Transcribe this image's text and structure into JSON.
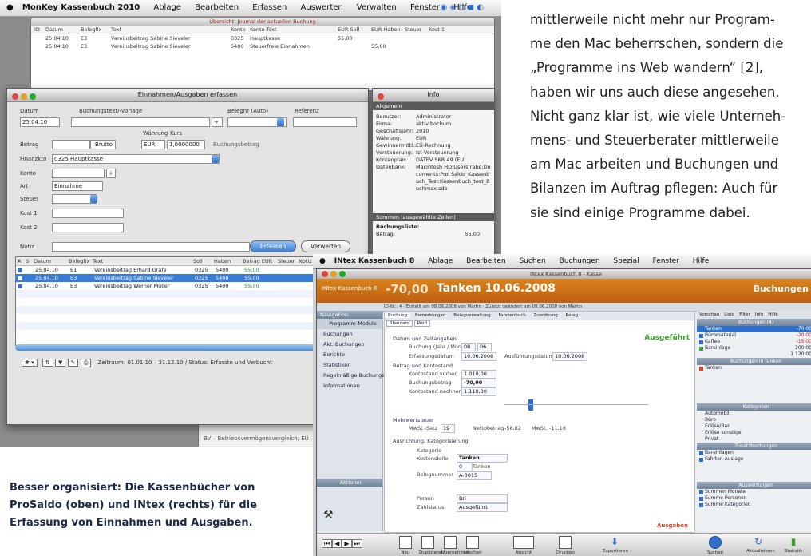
{
  "article": {
    "lines": [
      "mittlerweile nicht mehr nur Program-",
      "me den Mac beherrschen, sondern die",
      "„Programme ins Web wandern“ [2],",
      "haben wir uns auch diese angesehen.",
      "Nicht ganz klar ist, wie viele Unterneh-",
      "mens- und Steuerberater mittlerweile",
      "am Mac arbeiten und Buchungen und",
      "Bilanzen im Auftrag pflegen: Auch für",
      "sie sind einige Programme dabei."
    ]
  },
  "caption": {
    "lines": [
      "Besser organisiert: Die Kassenbücher von",
      "ProSaldo (oben) und INtex (rechts) für die",
      "Erfassung von Einnahmen und Ausgaben."
    ]
  },
  "monkey": {
    "menubar": {
      "app": "MonKey Kassenbuch 2010",
      "items": [
        "Ablage",
        "Bearbeiten",
        "Erfassen",
        "Auswerten",
        "Verwalten",
        "Fenster",
        "Hilfe"
      ]
    },
    "journal": {
      "title": "Übersicht: Journal der aktuellen Buchung",
      "columns": [
        "ID",
        "Datum",
        "Belegfix",
        "Text",
        "Konto",
        "Konto-Text",
        "EUR Soll",
        "EUR Haben",
        "Steuer",
        "Kost 1"
      ],
      "rows": [
        [
          "",
          "25.04.10",
          "E3",
          "Vereinsbeitrag Sabine Sieveler",
          "0325",
          "Hauptkasse",
          "55,00",
          "",
          "",
          ""
        ],
        [
          "",
          "25.04.10",
          "E3",
          "Vereinsbeitrag Sabine Sieveler",
          "5400",
          "Steuerfreie Einnahmen",
          "",
          "55,00",
          "",
          ""
        ]
      ]
    },
    "eingabe": {
      "title": "Einnahmen/Ausgaben erfassen",
      "labels": {
        "datum": "Datum",
        "vorlage": "Buchungstext/-vorlage",
        "beleg": "Belegnr (Auto)",
        "referenz": "Referenz",
        "betrag": "Betrag",
        "finanzkto": "Finanzkto",
        "konto": "Konto",
        "art": "Art",
        "steuer": "Steuer",
        "kost1": "Kost 1",
        "kost2": "Kost 2",
        "notiz": "Notiz",
        "waehrung": "Währung",
        "kurs": "Kurs"
      },
      "values": {
        "datum": "25.04.10",
        "finanzkto": "0325 Hauptkasse",
        "art": "Einnahme",
        "waehrung": "EUR",
        "kurs": "1,0000000",
        "brutto": "Brutto",
        "buchungsbetrag": "Buchungsbetrag"
      },
      "buttons": {
        "erfassen": "Erfassen",
        "verwerfen": "Verwerfen"
      },
      "table": {
        "columns": [
          "A",
          "S",
          "Datum",
          "Belegfix",
          "Text",
          "Soll",
          "Haben",
          "",
          "Betrag EUR",
          "Steuer",
          "Notiz"
        ],
        "rows": [
          [
            "",
            "",
            "25.04.10",
            "E1",
            "Vereinsbeitrag Erhard Gräfe",
            "0325",
            "5400",
            "",
            "55,00",
            "",
            ""
          ],
          [
            "",
            "",
            "25.04.10",
            "E3",
            "Vereinsbeitrag Sabine Sieveler",
            "0325",
            "5400",
            "",
            "55,00",
            "",
            ""
          ],
          [
            "",
            "",
            "25.04.10",
            "E3",
            "Vereinsbeitrag Werner Müller",
            "0325",
            "5400",
            "",
            "55,00",
            "",
            ""
          ]
        ]
      },
      "status": "Zeitraum: 01.01.10 – 31.12.10 / Status: Erfasste und Verbucht"
    },
    "info": {
      "title": "Info",
      "section1": "Allgemein",
      "rows": [
        [
          "Benutzer:",
          "Administrator"
        ],
        [
          "Firma:",
          "aktiv bochum"
        ],
        [
          "Geschäftsjahr:",
          "2010"
        ],
        [
          "Währung:",
          "EUR"
        ],
        [
          "Gewinnermittl.:",
          "EÜ-Rechnung"
        ],
        [
          "Versteuerung:",
          "Ist-Versteuerung"
        ],
        [
          "Kontenplan:",
          "DATEV SKR 49 (EU)"
        ],
        [
          "Datenbank:",
          "Macintosh HD:Users:rabe:Documents:Pro_Saldo_Kassenbuch_Test:Kassenbuch_test_Buchmax.sdb"
        ]
      ],
      "section2": "Summen (ausgewählte Zeilen)",
      "sum_label": "Buchungsliste:",
      "sum_key": "Betrag:",
      "sum_value": "55,00"
    },
    "behind_text": "BV – Betriebsvermögensvergleich; EÜ – Einnahme..."
  },
  "intex": {
    "menubar": {
      "app": "INtex Kassenbuch 8",
      "items": [
        "Ablage",
        "Bearbeiten",
        "Suchen",
        "Buchungen",
        "Spezial",
        "Fenster",
        "Hilfe"
      ]
    },
    "window_title": "INtex Kassenbuch 8 - Kasse",
    "header": {
      "app": "INtex Kassenbuch 8",
      "amount": "-70,00",
      "title": "Tanken 10.06.2008",
      "section": "Buchungen",
      "sub": "ID-Nr.: 4 · Erstellt am 08.06.2008 von Martin · Zuletzt geändert am 08.06.2008 von Martin"
    },
    "nav": {
      "head": "Navigation",
      "sub": "Programm-Module",
      "items": [
        "Buchungen",
        "Akt. Buchungen",
        "Berichte",
        "Statistiken",
        "Regelmäßige Buchungen",
        "Informationen"
      ],
      "bottom": "Aktionen"
    },
    "tabs": [
      "Buchung",
      "Bemerkungen",
      "Belegverwaltung",
      "Fahrtenbuch",
      "Zuordnung",
      "Beleg"
    ],
    "subtabs": [
      "Standard",
      "Profi"
    ],
    "status_word": "Ausgeführt",
    "form": {
      "sec_datum": "Datum und Zeitangaben",
      "datum_label": "Buchung (Jahr / Mon.)",
      "datum_vals": [
        "08",
        "06"
      ],
      "erfasst_label": "Erfassungsdatum",
      "erfasst_val": "10.06.2008",
      "fill_label": "Ausführungsdatum",
      "fill_val": "10.06.2008",
      "sec_betrag": "Betrag und Kontostand",
      "konto_label": "Kontostand vorher",
      "konto_val": "1.010,00",
      "betrag_label": "Buchungsbetrag",
      "betrag_val": "-70,00",
      "nach_label": "Kontostand nachher",
      "nach_val": "1.110,00",
      "sec_mwst": "Mehrwertsteuer",
      "mwst_label": "MwSt.-Satz",
      "mwst_val": "19",
      "netto_label": "Nettobetrag",
      "netto_val": "-58,82",
      "steuer_label": "MwSt.",
      "steuer_val": "-11,18",
      "sec_ausr": "Ausrichtung, Kategorisierung",
      "kat_label": "Kategorie",
      "kat_val": "Tanken",
      "kst_label": "Kostenstelle",
      "kst_val": "0",
      "kst_unit": "Tanken",
      "beleg_label": "Belegnummer",
      "beleg_val": "A-0015",
      "person_label": "Person",
      "person_val": "Bri",
      "status_label": "Zahlstatus",
      "status_val": "Ausgeführt",
      "footer_red": "Ausgaben"
    },
    "right": {
      "tabs": [
        "Vorschau",
        "Liste",
        "Filter",
        "Info",
        "Hilfe"
      ],
      "head1": "Buchungen (4)",
      "list": [
        {
          "label": "Tanken",
          "value": "-70,00"
        },
        {
          "label": "Büromaterial",
          "value": "-20,00"
        },
        {
          "label": "Kaffee",
          "value": "-15,00"
        },
        {
          "label": "Bareinlage",
          "value": "200,00"
        }
      ],
      "sum": "1.120,00",
      "head2": "Buchungen in Tanken",
      "list2": [
        "Tanken"
      ],
      "head3": "Kategorien",
      "cats": [
        "Automobil",
        "Büro",
        "Erlöse/Bar",
        "Erlöse sonstige",
        "Privat"
      ],
      "head4": "Zusatzbuchungen",
      "extra": [
        "Bareinlagen",
        "Fahrten Auslage"
      ],
      "head5": "Auswertungen",
      "auswert": [
        "Summen Monate",
        "Summe Personen",
        "Summe Kategorien"
      ]
    },
    "toolbar": [
      "Neu",
      "Duplizieren",
      "Übernehmen",
      "Löschen",
      "Ansicht",
      "Drucken",
      "Exportieren",
      "Suchen",
      "Aktualisieren",
      "Statistik"
    ]
  }
}
